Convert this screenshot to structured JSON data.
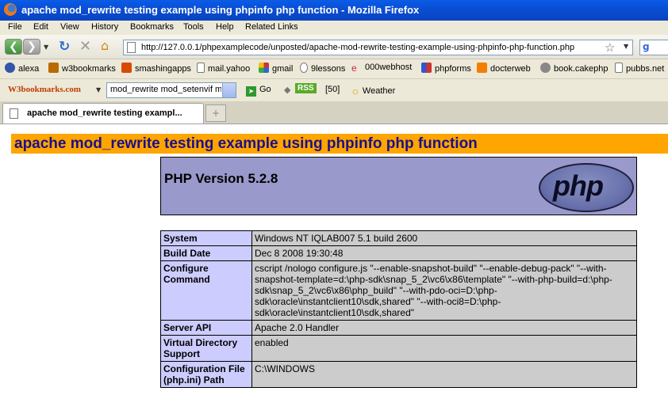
{
  "window": {
    "title": "apache mod_rewrite testing example using phpinfo php function - Mozilla Firefox"
  },
  "menu": {
    "items": [
      "File",
      "Edit",
      "View",
      "History",
      "Bookmarks",
      "Tools",
      "Help",
      "Related Links"
    ]
  },
  "navigation": {
    "url": "http://127.0.0.1/phpexamplecode/unposted/apache-mod-rewrite-testing-example-using-phpinfo-php-function.php",
    "search_engine_icon": "google-icon"
  },
  "bookmarks": [
    {
      "label": "alexa",
      "icon": "alexa-icon",
      "color": "#3355aa"
    },
    {
      "label": "w3bookmarks",
      "icon": "w3-icon",
      "color": "#b86a00"
    },
    {
      "label": "smashingapps",
      "icon": "s-icon",
      "color": "#d84a00"
    },
    {
      "label": "mail.yahoo",
      "icon": "page-icon",
      "color": "#ffffff"
    },
    {
      "label": "gmail",
      "icon": "gmail-icon",
      "color": "#cc3333"
    },
    {
      "label": "9lessons",
      "icon": "page-icon",
      "color": "#ffffff"
    },
    {
      "label": "000webhost",
      "icon": "swirl-icon",
      "color": "#cc2244"
    },
    {
      "label": "phpforms",
      "icon": "grid-icon",
      "color": "#3355cc"
    },
    {
      "label": "docterweb",
      "icon": "blogger-icon",
      "color": "#f57d00"
    },
    {
      "label": "book.cakephp",
      "icon": "cake-icon",
      "color": "#888888"
    },
    {
      "label": "pubbs.net",
      "icon": "page-icon",
      "color": "#ffffff"
    }
  ],
  "toolbar2": {
    "logo": "W3bookmarks.com",
    "select_value": "mod_rewrite mod_setenvif m",
    "go_label": "Go",
    "rss_label": "RSS",
    "count_label": "[50]",
    "weather_label": "Weather"
  },
  "tabs": [
    {
      "label": "apache mod_rewrite testing exampl...",
      "active": true
    }
  ],
  "page": {
    "heading": "apache mod_rewrite testing example using phpinfo php function",
    "php_version": "PHP Version 5.2.8",
    "php_logo_text": "php",
    "info_rows": [
      {
        "key": "System",
        "value": "Windows NT IQLAB007 5.1 build 2600"
      },
      {
        "key": "Build Date",
        "value": "Dec 8 2008 19:30:48"
      },
      {
        "key": "Configure Command",
        "value": "cscript /nologo configure.js \"--enable-snapshot-build\" \"--enable-debug-pack\" \"--with-snapshot-template=d:\\php-sdk\\snap_5_2\\vc6\\x86\\template\" \"--with-php-build=d:\\php-sdk\\snap_5_2\\vc6\\x86\\php_build\" \"--with-pdo-oci=D:\\php-sdk\\oracle\\instantclient10\\sdk,shared\" \"--with-oci8=D:\\php-sdk\\oracle\\instantclient10\\sdk,shared\""
      },
      {
        "key": "Server API",
        "value": "Apache 2.0 Handler"
      },
      {
        "key": "Virtual Directory Support",
        "value": "enabled"
      },
      {
        "key": "Configuration File (php.ini) Path",
        "value": "C:\\WINDOWS"
      }
    ]
  },
  "colors": {
    "heading_bg": "#ffa500",
    "heading_text": "#1a0f8a",
    "php_header_bg": "#9999cc",
    "key_cell_bg": "#ccccff",
    "value_cell_bg": "#cccccc",
    "titlebar_bg": "#0a4fd4"
  }
}
